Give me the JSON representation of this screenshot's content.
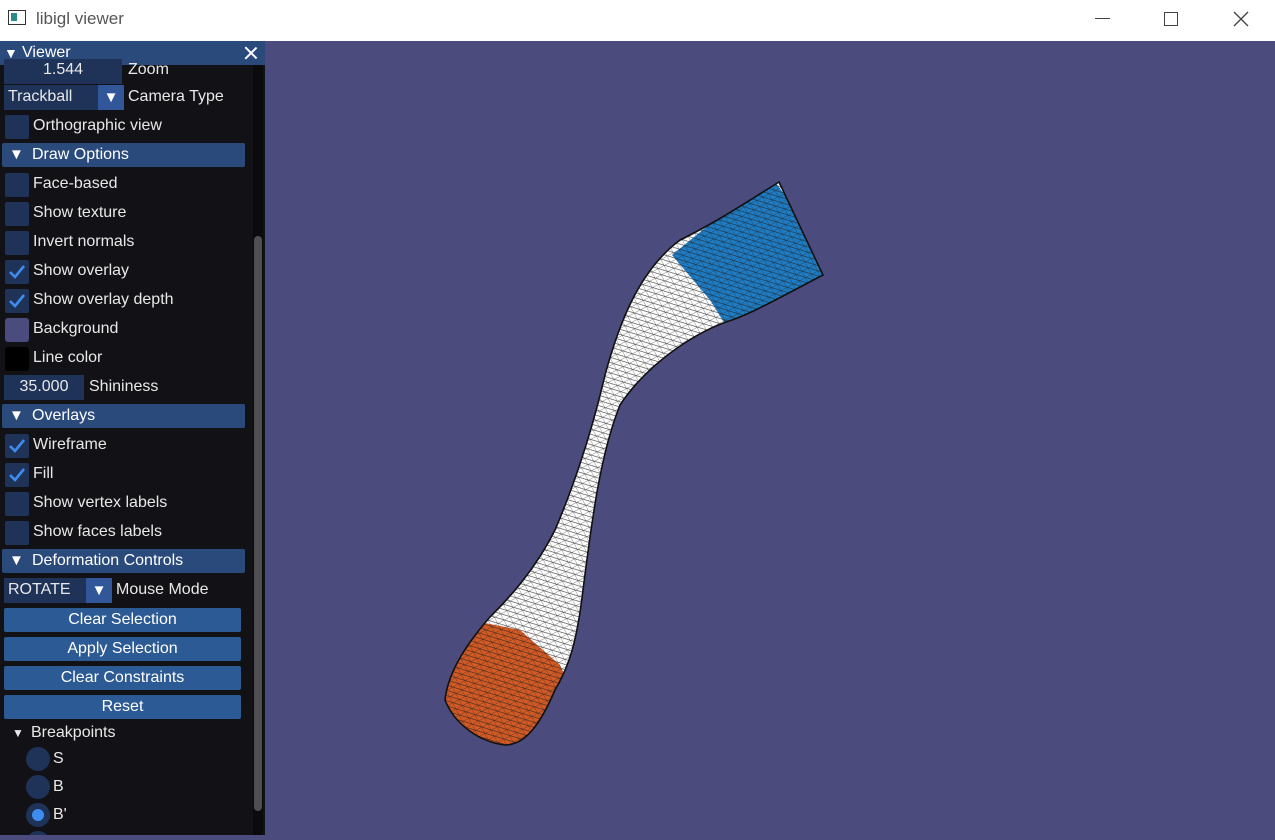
{
  "window": {
    "title": "libigl viewer"
  },
  "panel": {
    "title": "Viewer",
    "zoom": {
      "value": "1.544",
      "label": "Zoom"
    },
    "camera_type": {
      "value": "Trackball",
      "label": "Camera Type"
    },
    "orthographic": {
      "label": "Orthographic view",
      "checked": false
    },
    "draw_options": {
      "title": "Draw Options",
      "face_based": {
        "label": "Face-based",
        "checked": false
      },
      "show_texture": {
        "label": "Show texture",
        "checked": false
      },
      "invert_normals": {
        "label": "Invert normals",
        "checked": false
      },
      "show_overlay": {
        "label": "Show overlay",
        "checked": true
      },
      "show_overlay_depth": {
        "label": "Show overlay depth",
        "checked": true
      },
      "background": {
        "label": "Background",
        "color": "#4c4b7e"
      },
      "line_color": {
        "label": "Line color",
        "color": "#000000"
      },
      "shininess": {
        "label": "Shininess",
        "value": "35.000"
      }
    },
    "overlays": {
      "title": "Overlays",
      "wireframe": {
        "label": "Wireframe",
        "checked": true
      },
      "fill": {
        "label": "Fill",
        "checked": true
      },
      "vertex_labels": {
        "label": "Show vertex labels",
        "checked": false
      },
      "face_labels": {
        "label": "Show faces labels",
        "checked": false
      }
    },
    "deformation": {
      "title": "Deformation Controls",
      "mouse_mode": {
        "value": "ROTATE",
        "label": "Mouse Mode"
      },
      "clear_selection": "Clear Selection",
      "apply_selection": "Apply Selection",
      "clear_constraints": "Clear Constraints",
      "reset": "Reset",
      "breakpoints": {
        "title": "Breakpoints",
        "options": [
          {
            "label": "S",
            "selected": false
          },
          {
            "label": "B",
            "selected": false
          },
          {
            "label": "B'",
            "selected": true
          }
        ]
      }
    }
  },
  "colors": {
    "accent": "#3f8cf0",
    "header": "#2b4a7c",
    "button": "#2c5a94",
    "viewport": "#4c4b7e",
    "handle_top": "#1e7cc4",
    "handle_bottom": "#d45a24",
    "mesh": "#ffffff"
  }
}
